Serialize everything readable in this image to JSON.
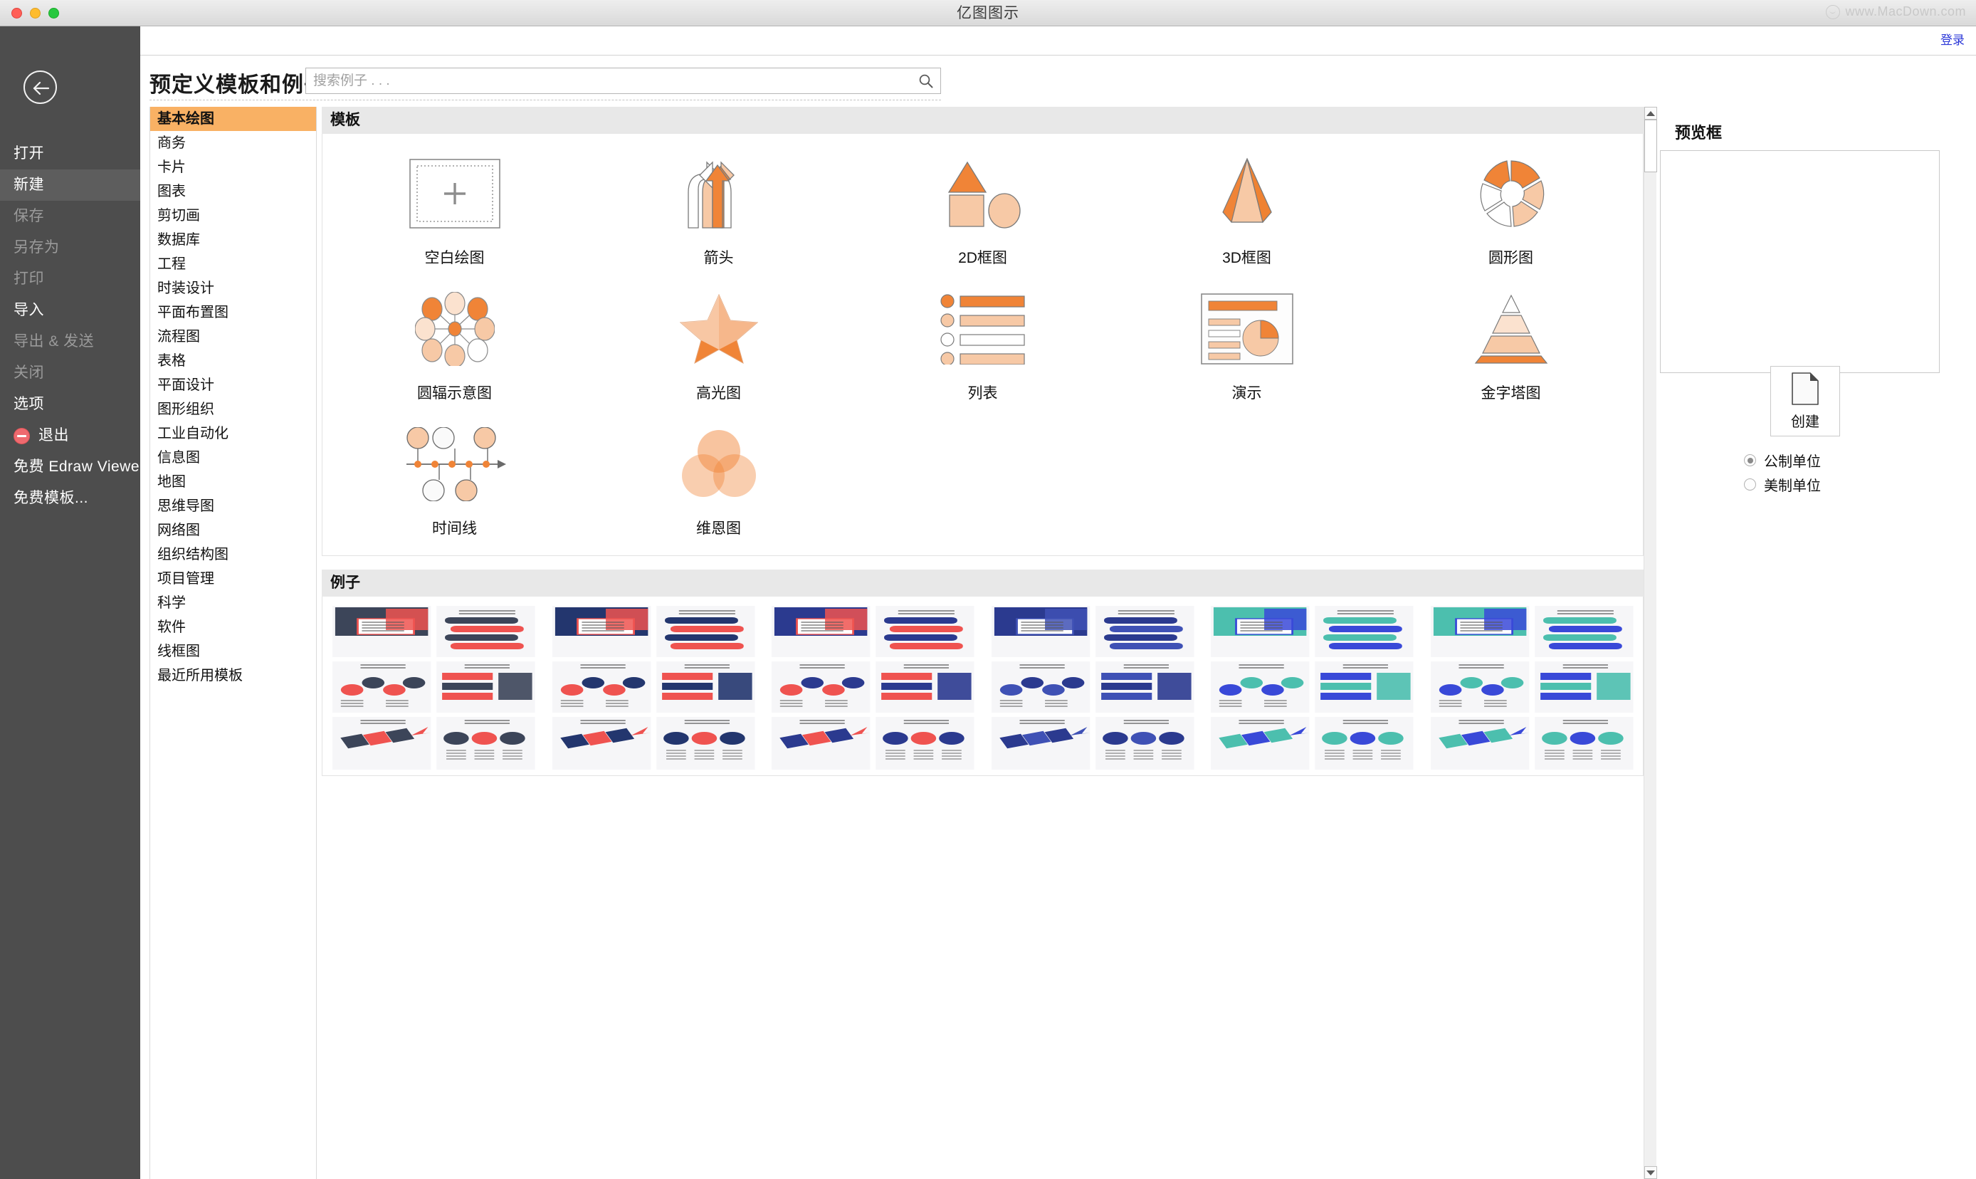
{
  "window": {
    "title": "亿图图示",
    "watermark": "www.MacDown.com",
    "controls": {
      "close": "close",
      "minimize": "minimize",
      "maximize": "maximize"
    }
  },
  "sidebar": {
    "back_icon": "back-arrow-icon",
    "items": [
      {
        "label": "打开",
        "state": "normal",
        "icon": null
      },
      {
        "label": "新建",
        "state": "active",
        "icon": null
      },
      {
        "label": "保存",
        "state": "disabled",
        "icon": null
      },
      {
        "label": "另存为",
        "state": "disabled",
        "icon": null
      },
      {
        "label": "打印",
        "state": "disabled",
        "icon": null
      },
      {
        "label": "导入",
        "state": "normal",
        "icon": null
      },
      {
        "label": "导出 & 发送",
        "state": "disabled",
        "icon": null
      },
      {
        "label": "关闭",
        "state": "disabled",
        "icon": null
      },
      {
        "label": "选项",
        "state": "normal",
        "icon": null
      },
      {
        "label": "退出",
        "state": "normal",
        "icon": "exit-icon"
      },
      {
        "label": "免费 Edraw Viewer",
        "state": "normal",
        "icon": null
      },
      {
        "label": "免费模板...",
        "state": "normal",
        "icon": null
      }
    ]
  },
  "header": {
    "login_label": "登录",
    "page_title": "预定义模板和例子",
    "search": {
      "value": "",
      "placeholder": "搜索例子 . . .",
      "icon": "search-icon"
    }
  },
  "categories": {
    "selected": "基本绘图",
    "items": [
      "基本绘图",
      "商务",
      "卡片",
      "图表",
      "剪切画",
      "数据库",
      "工程",
      "时装设计",
      "平面布置图",
      "流程图",
      "表格",
      "平面设计",
      "图形组织",
      "工业自动化",
      "信息图",
      "地图",
      "思维导图",
      "网络图",
      "组织结构图",
      "项目管理",
      "科学",
      "软件",
      "线框图",
      "最近所用模板"
    ]
  },
  "templates": {
    "section_title": "模板",
    "items": [
      {
        "label": "空白绘图",
        "art": "blank"
      },
      {
        "label": "箭头",
        "art": "arrows"
      },
      {
        "label": "2D框图",
        "art": "block2d"
      },
      {
        "label": "3D框图",
        "art": "block3d"
      },
      {
        "label": "圆形图",
        "art": "circular"
      },
      {
        "label": "圆辐示意图",
        "art": "spoke"
      },
      {
        "label": "高光图",
        "art": "star"
      },
      {
        "label": "列表",
        "art": "list"
      },
      {
        "label": "演示",
        "art": "presentation"
      },
      {
        "label": "金字塔图",
        "art": "pyramid"
      },
      {
        "label": "时间线",
        "art": "timeline"
      },
      {
        "label": "维恩图",
        "art": "venn"
      }
    ]
  },
  "examples": {
    "section_title": "例子",
    "items": [
      {
        "art": "ex-red-a"
      },
      {
        "art": "ex-red-b"
      },
      {
        "art": "ex-blue-a"
      },
      {
        "art": "ex-blue-b"
      },
      {
        "art": "ex-teal-a"
      },
      {
        "art": "ex-teal-b"
      },
      {
        "art": "ex-yellow-a"
      },
      {
        "art": "ex-yellow-b"
      }
    ]
  },
  "scrollbar": {
    "up_icon": "chevron-up-icon",
    "down_icon": "chevron-down-icon"
  },
  "preview": {
    "title": "预览框",
    "create": {
      "label": "创建",
      "icon": "new-document-icon"
    },
    "units": {
      "selected": "公制单位",
      "options": [
        "公制单位",
        "美制单位"
      ]
    }
  },
  "colors": {
    "accent_orange": "#f08437",
    "accent_light": "#f7c9a6",
    "selected_category": "#f9b164",
    "sidebar_bg": "#4d4d4d",
    "link_blue": "#2b37d8"
  }
}
